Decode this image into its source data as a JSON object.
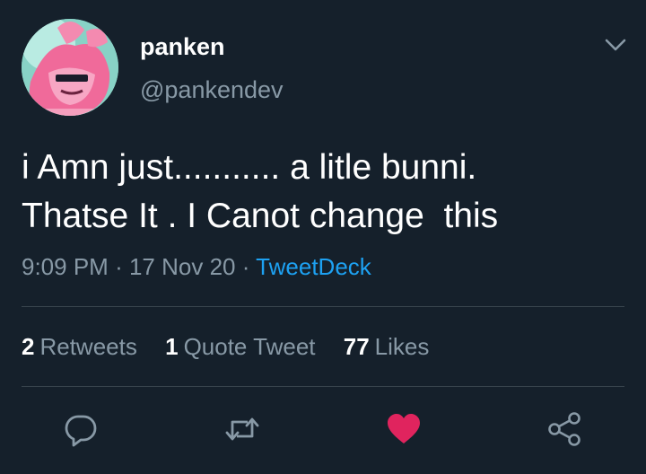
{
  "author": {
    "display_name": "panken",
    "handle": "@pankendev"
  },
  "tweet": {
    "text": "i Amn just........... a litle bunni.\nThatse It . I Canot change  this",
    "time": "9:09 PM",
    "date": "17 Nov 20",
    "source": "TweetDeck",
    "separator": "·"
  },
  "stats": {
    "retweets_count": "2",
    "retweets_label": "Retweets",
    "quotes_count": "1",
    "quotes_label": "Quote Tweet",
    "likes_count": "77",
    "likes_label": "Likes"
  },
  "actions": {
    "icons": [
      "reply-icon",
      "retweet-icon",
      "like-icon",
      "share-icon"
    ],
    "liked": true
  },
  "colors": {
    "background": "#15202b",
    "text_primary": "#ffffff",
    "text_secondary": "#8899a6",
    "accent": "#1da1f2",
    "like_active": "#e0245e",
    "divider": "#38444d"
  }
}
